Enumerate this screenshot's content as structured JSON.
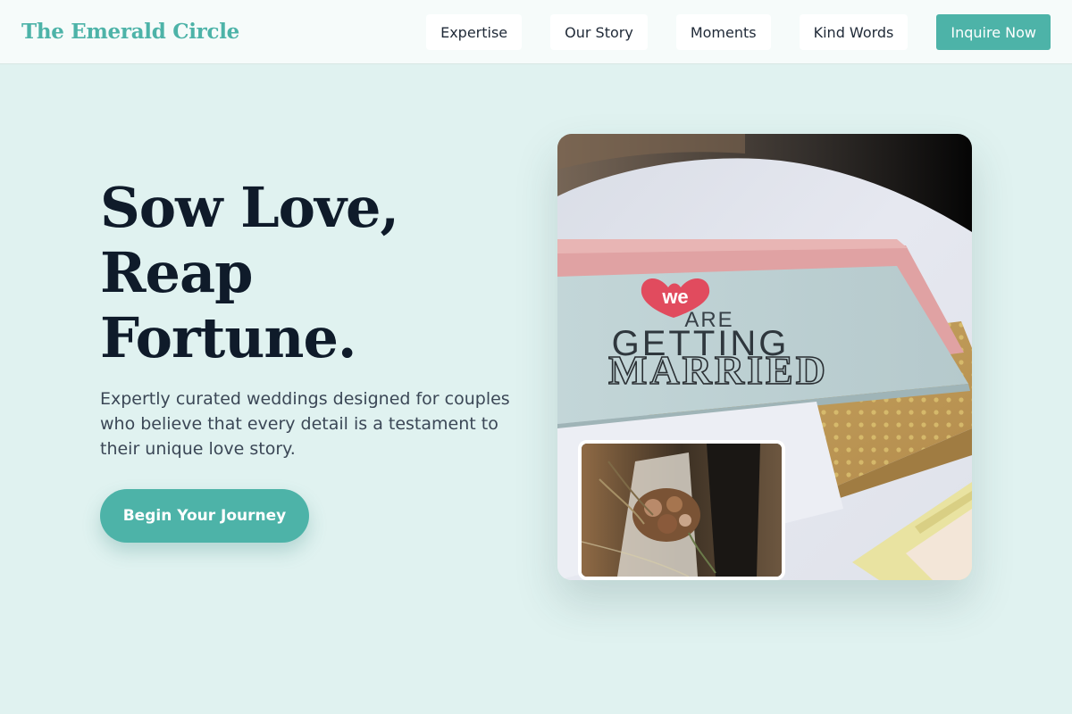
{
  "header": {
    "brand": "The Emerald Circle",
    "nav": [
      "Expertise",
      "Our Story",
      "Moments",
      "Kind Words"
    ],
    "cta": "Inquire Now"
  },
  "hero": {
    "title_lines": [
      "Sow Love,",
      "Reap",
      "Fortune."
    ],
    "subtitle": "Expertly curated weddings designed for couples who believe that every detail is a testament to their unique love story.",
    "button": "Begin Your Journey"
  },
  "card_image": {
    "heart_text": "we",
    "line1": "ARE",
    "line2": "GETTING",
    "line3": "MARRIED"
  },
  "colors": {
    "accent": "#4db3a8",
    "background": "#e0f2f0",
    "heading": "#0f1b2a"
  }
}
